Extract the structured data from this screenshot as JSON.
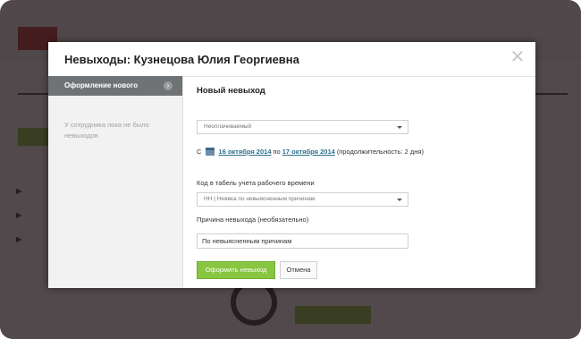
{
  "modal": {
    "title": "Невыходы: Кузнецова Юлия Георгиевна",
    "close_icon": "close-icon"
  },
  "sidebar": {
    "active_item": "Оформление нового",
    "empty_text": "У сотрудника пока не было невыходов"
  },
  "form": {
    "section_title": "Новый невыход",
    "type_select": {
      "value": "Неоплачиваемый"
    },
    "dates": {
      "prefix": "С",
      "start": "16 октября 2014",
      "middle": "по",
      "end": "17 октября 2014",
      "duration": "(продолжительность: 2 дня)"
    },
    "timesheet_code": {
      "label": "Код в табель учета рабочего времени",
      "value": "НН | Неявка по невыясненным причинам"
    },
    "reason": {
      "label": "Причина невыхода (необязательно)",
      "value": "По невыясненным причинам"
    },
    "submit_label": "Оформить невыход",
    "cancel_label": "Отмена"
  },
  "colors": {
    "overlay": "#22181b",
    "sidebar_active": "#707375",
    "primary_button": "#88c540",
    "link": "#2e6f8e"
  }
}
